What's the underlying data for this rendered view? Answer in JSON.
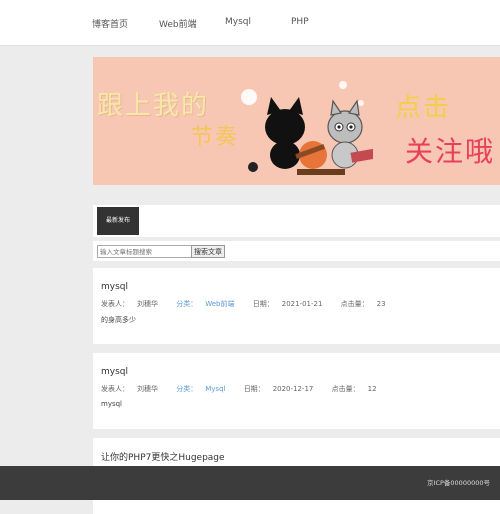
{
  "nav": {
    "items": [
      "博客首页",
      "Web前端",
      "Mysql",
      "PHP"
    ]
  },
  "banner": {
    "line1": "跟上我的",
    "line2": "节奏",
    "line3": "点击",
    "line4": "关注哦"
  },
  "tabs": {
    "active": "最新发布"
  },
  "search": {
    "placeholder": "输入文章标题搜索",
    "button": "搜索文章"
  },
  "posts": [
    {
      "title": "mysql",
      "author_label": "发表人：",
      "author": "刘穗华",
      "category_label": "分类：",
      "category": "Web前端",
      "date_label": "日期：",
      "date": "2021-01-21",
      "views_label": "点击量：",
      "views": "23",
      "excerpt": "的身高多少"
    },
    {
      "title": "mysql",
      "author_label": "发表人：",
      "author": "刘穗华",
      "category_label": "分类：",
      "category": "Mysql",
      "date_label": "日期：",
      "date": "2020-12-17",
      "views_label": "点击量：",
      "views": "12",
      "excerpt": "mysql"
    },
    {
      "title": "让你的PHP7更快之Hugepage"
    }
  ],
  "footer": {
    "icp": "京ICP备00000000号"
  }
}
